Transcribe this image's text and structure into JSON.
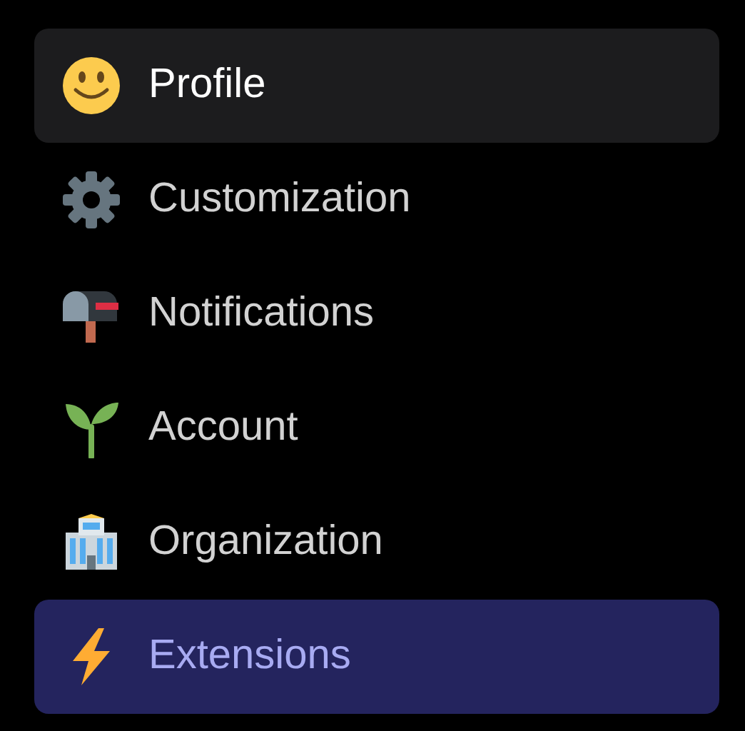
{
  "menu": {
    "items": [
      {
        "label": "Profile",
        "selected": false,
        "hovered": true
      },
      {
        "label": "Customization",
        "selected": false,
        "hovered": false
      },
      {
        "label": "Notifications",
        "selected": false,
        "hovered": false
      },
      {
        "label": "Account",
        "selected": false,
        "hovered": false
      },
      {
        "label": "Organization",
        "selected": false,
        "hovered": false
      },
      {
        "label": "Extensions",
        "selected": true,
        "hovered": false
      }
    ]
  }
}
